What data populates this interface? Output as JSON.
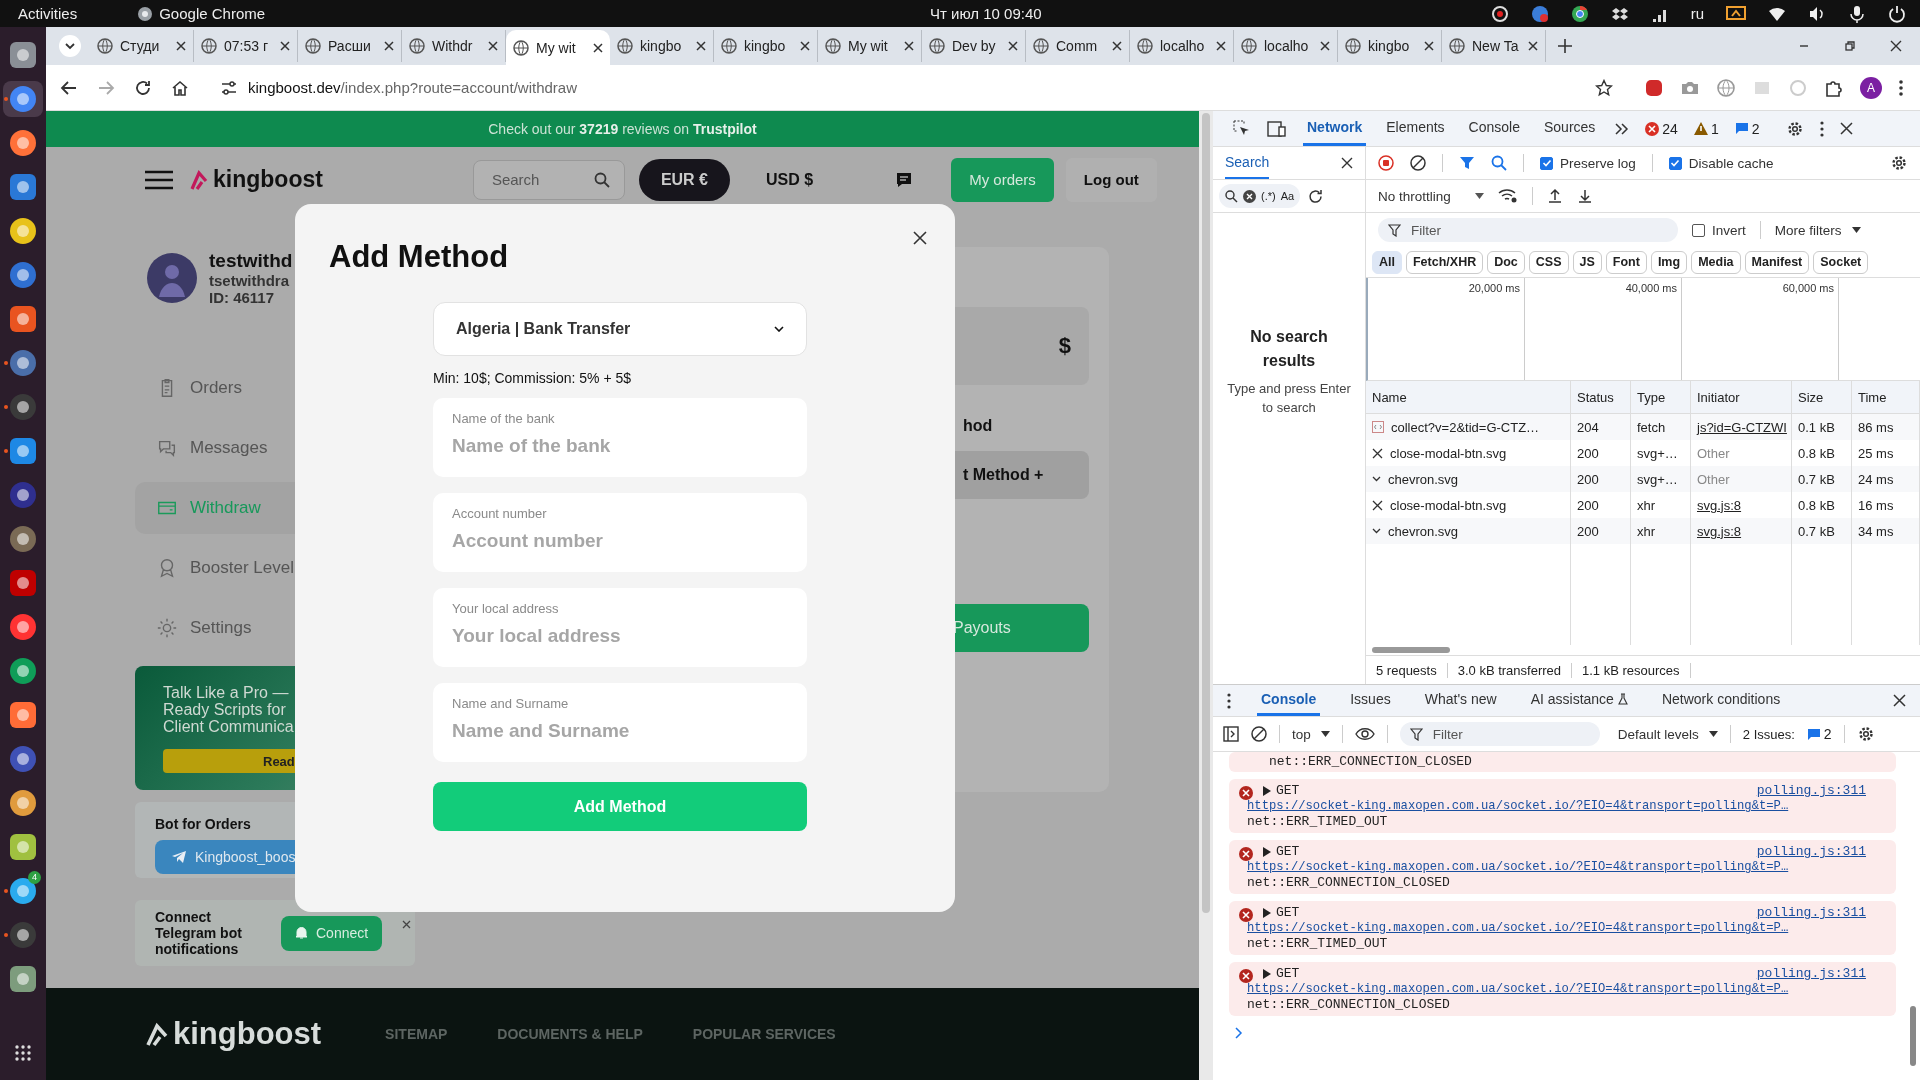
{
  "system_bar": {
    "activities": "Activities",
    "app": "Google Chrome",
    "clock": "Чт июл 10  09:40",
    "language": "ru"
  },
  "dock": {
    "apps": [
      {
        "selected": false,
        "running": false
      },
      {
        "selected": true,
        "running": true
      },
      {
        "selected": false,
        "running": false
      },
      {
        "selected": false,
        "running": false
      },
      {
        "selected": false,
        "running": false
      },
      {
        "selected": false,
        "running": false
      },
      {
        "selected": false,
        "running": false
      },
      {
        "selected": false,
        "running": true
      },
      {
        "selected": false,
        "running": true
      },
      {
        "selected": false,
        "running": true
      },
      {
        "selected": false,
        "running": false
      },
      {
        "selected": false,
        "running": false
      },
      {
        "selected": false,
        "running": false
      },
      {
        "selected": false,
        "running": false
      },
      {
        "selected": false,
        "running": false
      },
      {
        "selected": false,
        "running": false
      },
      {
        "selected": false,
        "running": false
      },
      {
        "selected": false,
        "running": false
      },
      {
        "selected": false,
        "running": false
      },
      {
        "selected": false,
        "running": true
      },
      {
        "selected": false,
        "running": true
      },
      {
        "selected": false,
        "running": false
      }
    ],
    "telegram_badge": "4"
  },
  "browser": {
    "tabs": [
      {
        "title": "Студи",
        "selected": false
      },
      {
        "title": "07:53 г",
        "selected": false
      },
      {
        "title": "Расши",
        "selected": false
      },
      {
        "title": "Withdr",
        "selected": false
      },
      {
        "title": "My wit",
        "selected": true
      },
      {
        "title": "kingbo",
        "selected": false
      },
      {
        "title": "kingbo",
        "selected": false
      },
      {
        "title": "My wit",
        "selected": false
      },
      {
        "title": "Dev by",
        "selected": false
      },
      {
        "title": "Comm",
        "selected": false
      },
      {
        "title": "localho",
        "selected": false
      },
      {
        "title": "localho",
        "selected": false
      },
      {
        "title": "kingbo",
        "selected": false
      },
      {
        "title": "New Ta",
        "selected": false
      }
    ],
    "url_host": "kingboost.dev",
    "url_path": "/index.php?route=account/withdraw",
    "profile_initial": "A"
  },
  "page": {
    "banner": "Check out our **37219** reviews on **Trustpilot**",
    "logo": "kingboost",
    "search_placeholder": "Search",
    "currencies": [
      {
        "label": "EUR €",
        "selected": true
      },
      {
        "label": "USD $",
        "selected": false
      }
    ],
    "my_orders": "My orders",
    "log_out": "Log out",
    "profile": {
      "name": "testwithd",
      "login": "tsetwithdra",
      "id": "ID: 46117"
    },
    "nav": [
      {
        "label": "Orders",
        "selected": false
      },
      {
        "label": "Messages",
        "selected": false
      },
      {
        "label": "Withdraw",
        "selected": true
      },
      {
        "label": "Booster Level",
        "selected": false
      },
      {
        "label": "Settings",
        "selected": false
      }
    ],
    "promo": {
      "lines": [
        "Talk Like a Pro —",
        "Ready Scripts for",
        "Client Communica"
      ],
      "button": "Read"
    },
    "bot": {
      "title": "Bot for Orders",
      "button": "Kingboost_boos"
    },
    "connect": {
      "text": "Connect Telegram bot notifications",
      "button": "Connect"
    },
    "content": {
      "currency": "$",
      "heading": "hod",
      "add_button": "t Method +",
      "payouts_button": "Payouts"
    },
    "footer": {
      "logo": "kingboost",
      "links": [
        "SITEMAP",
        "DOCUMENTS & HELP",
        "POPULAR SERVICES"
      ]
    }
  },
  "modal": {
    "title": "Add Method",
    "method": "Algeria | Bank Transfer",
    "note": "Min: 10$; Commission: 5% + 5$",
    "fields": [
      {
        "label": "Name of the bank",
        "placeholder": "Name of the bank"
      },
      {
        "label": "Account number",
        "placeholder": "Account number"
      },
      {
        "label": "Your local address",
        "placeholder": "Your local address"
      },
      {
        "label": "Name and Surname",
        "placeholder": "Name and Surname"
      }
    ],
    "submit": "Add Method"
  },
  "devtools": {
    "tabs": [
      {
        "label": "Network",
        "selected": true
      },
      {
        "label": "Elements",
        "selected": false
      },
      {
        "label": "Console",
        "selected": false
      },
      {
        "label": "Sources",
        "selected": false
      }
    ],
    "errors": "24",
    "warnings": "1",
    "infos": "2",
    "search": {
      "tab": "Search",
      "regex": "(.*)",
      "case": "Aa",
      "empty_title": "No search results",
      "empty_hint": "Type and press Enter to search"
    },
    "preserve_log": {
      "label": "Preserve log",
      "checked": true
    },
    "disable_cache": {
      "label": "Disable cache",
      "checked": true
    },
    "throttling": "No throttling",
    "filter_placeholder": "Filter",
    "invert": {
      "label": "Invert",
      "checked": false
    },
    "more_filters": "More filters",
    "type_filters": [
      {
        "label": "All",
        "selected": true
      },
      {
        "label": "Fetch/XHR",
        "selected": false
      },
      {
        "label": "Doc",
        "selected": false
      },
      {
        "label": "CSS",
        "selected": false
      },
      {
        "label": "JS",
        "selected": false
      },
      {
        "label": "Font",
        "selected": false
      },
      {
        "label": "Img",
        "selected": false
      },
      {
        "label": "Media",
        "selected": false
      },
      {
        "label": "Manifest",
        "selected": false
      },
      {
        "label": "Socket",
        "selected": false
      }
    ],
    "timeline_ticks": [
      "20,000 ms",
      "40,000 ms",
      "60,000 ms"
    ],
    "columns": [
      "Name",
      "Status",
      "Type",
      "Initiator",
      "Size",
      "Time"
    ],
    "rows": [
      {
        "kind": "fetch",
        "name": "collect?v=2&tid=G-CTZ…",
        "status": "204",
        "type": "fetch",
        "initiator": "js?id=G-CTZWI",
        "initiator_link": true,
        "size": "0.1 kB",
        "time": "86 ms"
      },
      {
        "kind": "close",
        "name": "close-modal-btn.svg",
        "status": "200",
        "type": "svg+…",
        "initiator": "Other",
        "initiator_link": false,
        "size": "0.8 kB",
        "time": "25 ms"
      },
      {
        "kind": "chevron",
        "name": "chevron.svg",
        "status": "200",
        "type": "svg+…",
        "initiator": "Other",
        "initiator_link": false,
        "size": "0.7 kB",
        "time": "24 ms"
      },
      {
        "kind": "close",
        "name": "close-modal-btn.svg",
        "status": "200",
        "type": "xhr",
        "initiator": "svg.js:8",
        "initiator_link": true,
        "size": "0.8 kB",
        "time": "16 ms"
      },
      {
        "kind": "chevron",
        "name": "chevron.svg",
        "status": "200",
        "type": "xhr",
        "initiator": "svg.js:8",
        "initiator_link": true,
        "size": "0.7 kB",
        "time": "34 ms"
      }
    ],
    "summary": [
      "5 requests",
      "3.0 kB transferred",
      "1.1 kB resources"
    ],
    "drawer_tabs": [
      {
        "label": "Console",
        "selected": true
      },
      {
        "label": "Issues",
        "selected": false
      },
      {
        "label": "What's new",
        "selected": false
      },
      {
        "label": "AI assistance",
        "selected": false
      },
      {
        "label": "Network conditions",
        "selected": false
      }
    ],
    "context": "top",
    "console_filter_placeholder": "Filter",
    "levels": "Default levels",
    "issues_label": "2 Issues:",
    "issues_count": "2",
    "partial_error": "net::ERR_CONNECTION_CLOSED",
    "messages": [
      {
        "method": "GET",
        "source": "polling.js:311",
        "url": "https://socket-king.maxopen.com.ua/socket.io/?EIO=4&transport=polling&t=P…",
        "error": "net::ERR_TIMED_OUT"
      },
      {
        "method": "GET",
        "source": "polling.js:311",
        "url": "https://socket-king.maxopen.com.ua/socket.io/?EIO=4&transport=polling&t=P…",
        "error": "net::ERR_CONNECTION_CLOSED"
      },
      {
        "method": "GET",
        "source": "polling.js:311",
        "url": "https://socket-king.maxopen.com.ua/socket.io/?EIO=4&transport=polling&t=P…",
        "error": "net::ERR_TIMED_OUT"
      },
      {
        "method": "GET",
        "source": "polling.js:311",
        "url": "https://socket-king.maxopen.com.ua/socket.io/?EIO=4&transport=polling&t=P…",
        "error": "net::ERR_CONNECTION_CLOSED"
      }
    ]
  }
}
